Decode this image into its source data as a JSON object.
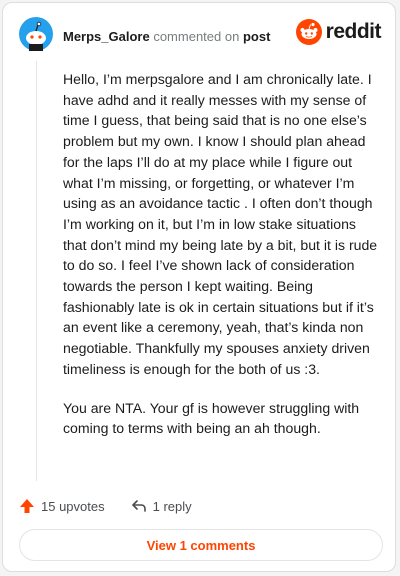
{
  "header": {
    "username": "Merps_Galore",
    "action_text": "commented on",
    "post_link": "post",
    "brand": "reddit"
  },
  "comment": {
    "paragraphs": [
      "Hello, I’m merpsgalore and I am chronically late. I have adhd and it really messes with my sense of time I guess, that being said that is no one else’s problem but my own. I know I should plan ahead for the laps I’ll do at my place while I figure out what I’m missing, or forgetting, or whatever I’m using as an avoidance tactic . I often don’t though I’m working on it, but I’m in low stake situations that don’t mind my being late by a bit, but it is rude to do so. I feel I’ve shown lack of consideration towards the person I kept waiting. Being fashionably late is ok in certain situations but if it’s an event like a ceremony, yeah, that’s kinda non negotiable. Thankfully my spouses anxiety driven timeliness is enough for the both of us :3.",
      "You are NTA. Your gf is however struggling with coming to terms with being an ah though."
    ]
  },
  "actions": {
    "upvotes": "15 upvotes",
    "replies": "1 reply"
  },
  "view_comments_label": "View 1 comments",
  "colors": {
    "accent": "#ff4500",
    "avatar_bg": "#24a0ed",
    "text": "#1c1c1c",
    "muted": "#787c7e"
  },
  "icons": {
    "avatar": "snoo-avatar-icon",
    "logo": "reddit-logo-icon",
    "upvote": "upvote-arrow-icon",
    "reply": "reply-arrow-icon"
  }
}
